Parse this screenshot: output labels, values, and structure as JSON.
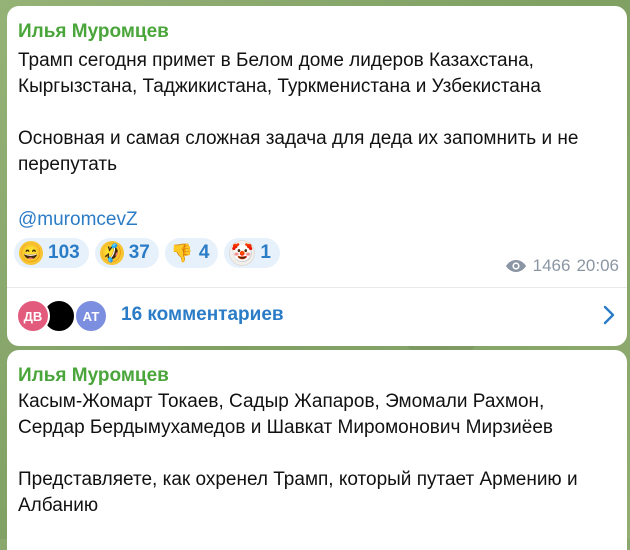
{
  "messages": [
    {
      "author": "Илья Муромцев",
      "text": "Трамп сегодня примет в Белом доме лидеров Казахстана,\nКыргызстана, Таджикистана, Туркменистана и Узбекистана\n\nОсновная и самая сложная задача для деда их запомнить и не\nперепутать",
      "link": "@muromcevZ",
      "reactions": [
        {
          "emoji": "😄",
          "icon": "grinning-face-icon",
          "count": "103"
        },
        {
          "emoji": "🤣",
          "icon": "rofl-face-icon",
          "count": "37"
        },
        {
          "emoji": "👎",
          "icon": "thumbs-down-icon",
          "count": "4"
        },
        {
          "emoji": "🤡",
          "icon": "clown-face-icon",
          "count": "1"
        }
      ],
      "views": "1466",
      "time": "20:06",
      "comments": {
        "avatars": [
          {
            "initials": "ДВ",
            "color": "#e35b7c"
          },
          {
            "initials": "",
            "color": "#000000"
          },
          {
            "initials": "АТ",
            "color": "#7c8ee0"
          }
        ],
        "label": "16 комментариев"
      }
    },
    {
      "author": "Илья Муромцев",
      "text": "Касым-Жомарт Токаев, Садыр Жапаров, Эмомали Рахмон,\nСердар Бердымухамедов и Шавкат Миромонович Мирзиёев\n\nПредставляете, как охренел Трамп, который путает Армению и\nАлбанию"
    }
  ],
  "colors": {
    "author": "#4aa53a",
    "link": "#2b7cc7",
    "reaction_bg": "#e7f1fb",
    "meta": "#8a96a3"
  }
}
